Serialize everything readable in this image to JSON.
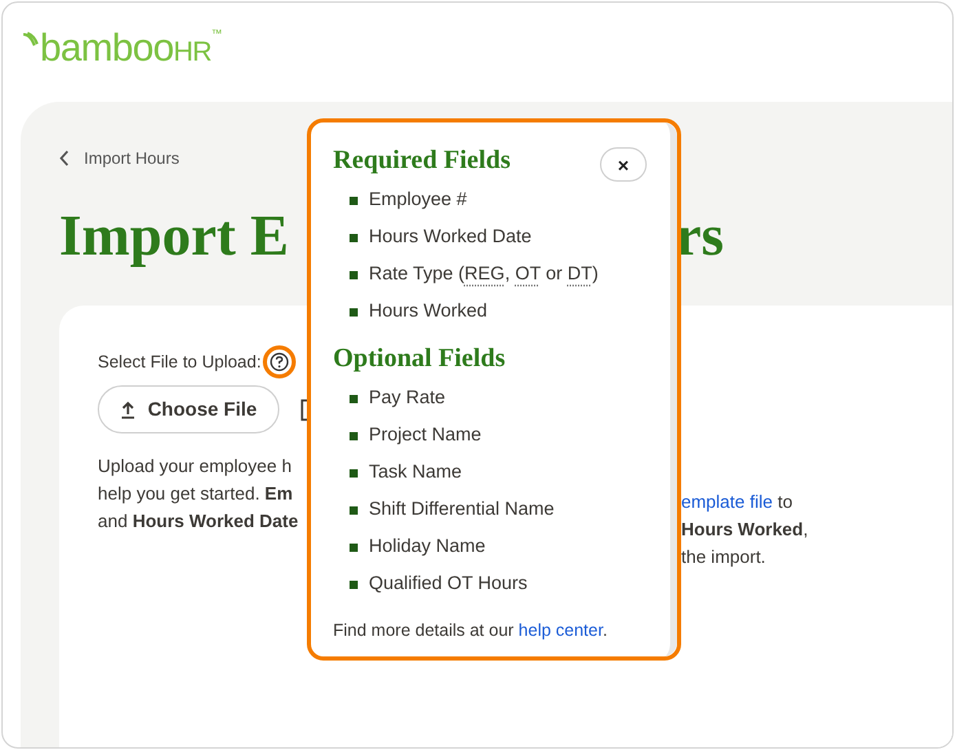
{
  "logo": {
    "word": "bamboo",
    "suffix": "HR",
    "trademark": "™"
  },
  "breadcrumb": {
    "label": "Import Hours"
  },
  "title": {
    "left": "Import E",
    "right": "rs"
  },
  "upload": {
    "label": "Select File to Upload:",
    "help_highlighted": true,
    "button": "Choose File"
  },
  "description": {
    "left_lines": [
      "Upload your employee h",
      "help you get started. **Em**",
      "and **Hours Worked Date**"
    ],
    "right_lines": [
      {
        "link": "emplate file",
        "text": " to"
      },
      {
        "text": "**Hours Worked**,"
      },
      {
        "text": "the import."
      }
    ]
  },
  "popover": {
    "highlighted": true,
    "close": "×",
    "sections": [
      {
        "title": "Required Fields",
        "items": [
          {
            "parts": [
              {
                "text": "Employee #"
              }
            ]
          },
          {
            "parts": [
              {
                "text": "Hours Worked Date"
              }
            ]
          },
          {
            "parts": [
              {
                "text": "Rate Type ("
              },
              {
                "text": "REG",
                "abbr": true
              },
              {
                "text": ", "
              },
              {
                "text": "OT",
                "abbr": true
              },
              {
                "text": " or "
              },
              {
                "text": "DT",
                "abbr": true
              },
              {
                "text": ")"
              }
            ]
          },
          {
            "parts": [
              {
                "text": "Hours Worked"
              }
            ]
          }
        ]
      },
      {
        "title": "Optional Fields",
        "items": [
          {
            "parts": [
              {
                "text": "Pay Rate"
              }
            ]
          },
          {
            "parts": [
              {
                "text": "Project Name"
              }
            ]
          },
          {
            "parts": [
              {
                "text": "Task Name"
              }
            ]
          },
          {
            "parts": [
              {
                "text": "Shift Differential Name"
              }
            ]
          },
          {
            "parts": [
              {
                "text": "Holiday Name"
              }
            ]
          },
          {
            "parts": [
              {
                "text": "Qualified OT Hours"
              }
            ]
          }
        ]
      }
    ],
    "footer": {
      "text": "Find more details at our ",
      "link": "help center",
      "after": "."
    }
  }
}
